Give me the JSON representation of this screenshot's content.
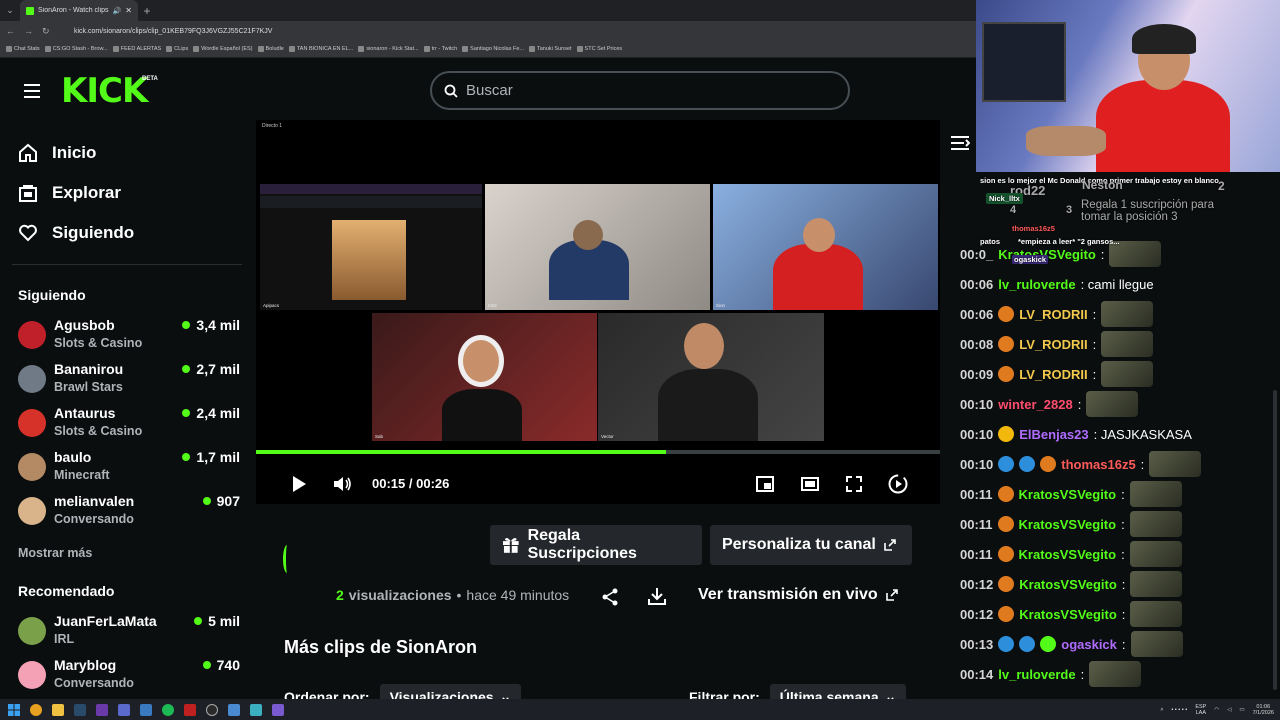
{
  "browser": {
    "tab_title": "SionAron - Watch clips on Kick",
    "url": "kick.com/sionaron/clips/clip_01KEB79FQ3J6VGZJ55C21F7KJV",
    "bookmarks": [
      "Chat Stats",
      "CS:GO Stash - Brow...",
      "FEED ALERTAS",
      "CLips",
      "Wordle Español (ES)",
      "Boludle",
      "TAN BIONICA EN EL...",
      "sionaron - Kick Stat...",
      "trr - Twitch",
      "Santiago Nicolas Fe...",
      "Tanuki Sunset",
      "STC Set Prices"
    ]
  },
  "header": {
    "logo": "KICK",
    "beta": "BETA",
    "search_placeholder": "Buscar"
  },
  "sidebar": {
    "nav": [
      {
        "label": "Inicio",
        "icon": "home-icon"
      },
      {
        "label": "Explorar",
        "icon": "explore-icon"
      },
      {
        "label": "Siguiendo",
        "icon": "heart-icon"
      }
    ],
    "following_title": "Siguiendo",
    "following": [
      {
        "name": "Agusbob",
        "category": "Slots & Casino",
        "viewers": "3,4 mil",
        "color": "#c0202a"
      },
      {
        "name": "Bananirou",
        "category": "Brawl Stars",
        "viewers": "2,7 mil",
        "color": "#6f7a86"
      },
      {
        "name": "Antaurus",
        "category": "Slots & Casino",
        "viewers": "2,4 mil",
        "color": "#d7322a"
      },
      {
        "name": "baulo",
        "category": "Minecraft",
        "viewers": "1,7 mil",
        "color": "#b38a63"
      },
      {
        "name": "melianvalen",
        "category": "Conversando",
        "viewers": "907",
        "color": "#d9b48a"
      }
    ],
    "show_more": "Mostrar más",
    "recommended_title": "Recomendado",
    "recommended": [
      {
        "name": "JuanFerLaMata",
        "category": "IRL",
        "viewers": "5 mil",
        "color": "#7aa04a"
      },
      {
        "name": "Maryblog",
        "category": "Conversando",
        "viewers": "740",
        "color": "#f4a0b5"
      }
    ]
  },
  "player": {
    "current_time": "00:15",
    "separator": "/",
    "duration": "00:26",
    "progress": 0.6,
    "call_title": "Directo 1",
    "tiles": [
      "Apipacs",
      "m22",
      "Sion",
      "Sab",
      "Vector"
    ]
  },
  "actions": {
    "gift_label": "Regala Suscripciones",
    "customize_label": "Personaliza tu canal",
    "views_count": "2",
    "views_label": "visualizaciones",
    "bullet": "•",
    "time_ago": "hace 49 minutos",
    "live_label": "Ver transmisión en vivo"
  },
  "more_clips": {
    "title": "Más clips de SionAron",
    "sort_label": "Ordenar por:",
    "sort_value": "Visualizaciones",
    "filter_label": "Filtrar por:",
    "filter_value": "Última semana"
  },
  "webcam_overlay": {
    "line1": "sion es lo mejor el Mc Donald como primer trabajo estoy en blanco",
    "name1": "Nick_lltx",
    "leader1": "rod22",
    "leader2": "Neston",
    "gift_text1": "Regala 1 suscripción para",
    "gift_text2": "tomar la posición 3",
    "user2": "thomas16z5",
    "line3": "patos",
    "line3b": "*empieza a leer* \"2 gansos...",
    "user4": "ogaskick",
    "rank_num": "2",
    "rank_small": "4",
    "rank_3": "3"
  },
  "chat": {
    "messages": [
      {
        "time": "00:0_",
        "user": "KratosVSVegito",
        "color": "#53fc18",
        "text": ":",
        "emote": true,
        "badges": []
      },
      {
        "time": "00:06",
        "user": "lv_ruloverde",
        "color": "#53fc18",
        "text": ": cami llegue",
        "emote": false,
        "badges": []
      },
      {
        "time": "00:06",
        "user": "LV_RODRII",
        "color": "#f2c94c",
        "text": ":",
        "emote": true,
        "badges": [
          "#e07a1f"
        ]
      },
      {
        "time": "00:08",
        "user": "LV_RODRII",
        "color": "#f2c94c",
        "text": ":",
        "emote": true,
        "badges": [
          "#e07a1f"
        ]
      },
      {
        "time": "00:09",
        "user": "LV_RODRII",
        "color": "#f2c94c",
        "text": ":",
        "emote": true,
        "badges": [
          "#e07a1f"
        ]
      },
      {
        "time": "00:10",
        "user": "winter_2828",
        "color": "#ff4d6d",
        "text": ":",
        "emote": true,
        "badges": []
      },
      {
        "time": "00:10",
        "user": "ElBenjas23",
        "color": "#b06cff",
        "text": ": JASJKASKASA",
        "emote": false,
        "badges": [
          "#f2b90c"
        ]
      },
      {
        "time": "00:10",
        "user": "thomas16z5",
        "color": "#ff5a5a",
        "text": ":",
        "emote": true,
        "badges": [
          "#2d8fdb",
          "#2d8fdb",
          "#e07a1f"
        ]
      },
      {
        "time": "00:11",
        "user": "KratosVSVegito",
        "color": "#53fc18",
        "text": ":",
        "emote": true,
        "badges": [
          "#e07a1f"
        ]
      },
      {
        "time": "00:11",
        "user": "KratosVSVegito",
        "color": "#53fc18",
        "text": ":",
        "emote": true,
        "badges": [
          "#e07a1f"
        ]
      },
      {
        "time": "00:11",
        "user": "KratosVSVegito",
        "color": "#53fc18",
        "text": ":",
        "emote": true,
        "badges": [
          "#e07a1f"
        ]
      },
      {
        "time": "00:12",
        "user": "KratosVSVegito",
        "color": "#53fc18",
        "text": ":",
        "emote": true,
        "badges": [
          "#e07a1f"
        ]
      },
      {
        "time": "00:12",
        "user": "KratosVSVegito",
        "color": "#53fc18",
        "text": ":",
        "emote": true,
        "badges": [
          "#e07a1f"
        ]
      },
      {
        "time": "00:13",
        "user": "ogaskick",
        "color": "#b06cff",
        "text": ":",
        "emote": true,
        "badges": [
          "#2d8fdb",
          "#2d8fdb",
          "#53fc18"
        ]
      },
      {
        "time": "00:14",
        "user": "lv_ruloverde",
        "color": "#53fc18",
        "text": ":",
        "emote": true,
        "badges": []
      }
    ]
  },
  "taskbar": {
    "lang1": "ESP",
    "lang2": "LAA",
    "time": "01:06",
    "date": "7/1/2026"
  },
  "colors": {
    "accent": "#53fc18",
    "bg": "#0b0e0f",
    "button": "#24272c"
  }
}
